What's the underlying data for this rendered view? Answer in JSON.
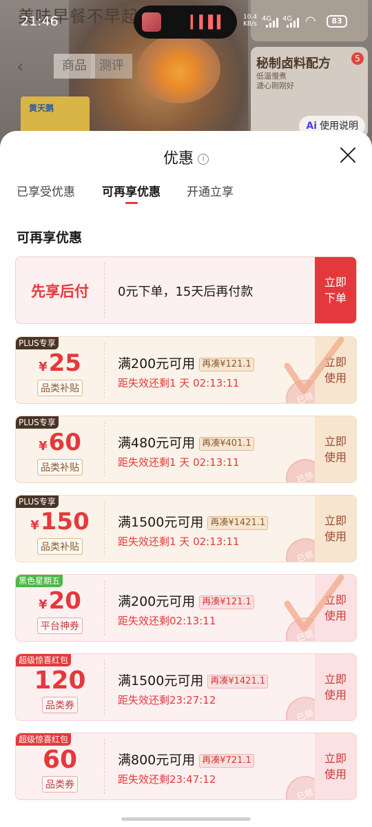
{
  "background": {
    "slogan": "美味早餐不早起",
    "tabs": [
      "商品",
      "测评"
    ],
    "product_brand": "黄天鹅",
    "card_title": "秘制卤料配方",
    "card_sub": [
      "低温慢煮",
      "溏心刚刚好"
    ],
    "card_badge": "5",
    "help_label": "使用说明",
    "help_icon": "Ai"
  },
  "status": {
    "time": "21:46",
    "net_speed": "10.4",
    "net_unit": "KB/s",
    "sig1": "4G",
    "sig2": "4G",
    "battery": "83"
  },
  "sheet": {
    "title": "优惠",
    "info_glyph": "i",
    "tabs": [
      "已享受优惠",
      "可再享优惠",
      "开通立享"
    ],
    "active_tab": 1,
    "section_title": "可再享优惠"
  },
  "pay_later": {
    "label": "先享后付",
    "desc": "0元下单，15天后再付款",
    "button": "立即下单"
  },
  "coupons": [
    {
      "tag": "PLUS专享",
      "amount": "25",
      "yen": "¥",
      "kind": "品类补贴",
      "cond": "满200元可用",
      "diff": "再凑¥121.1",
      "expire": "距失效还剩1 天 02:13:11",
      "button": "立即使用",
      "stamp": "已领",
      "checked": true
    },
    {
      "tag": "PLUS专享",
      "amount": "60",
      "yen": "¥",
      "kind": "品类补贴",
      "cond": "满480元可用",
      "diff": "再凑¥401.1",
      "expire": "距失效还剩1 天 02:13:11",
      "button": "立即使用",
      "stamp": "已领",
      "checked": false
    },
    {
      "tag": "PLUS专享",
      "amount": "150",
      "yen": "¥",
      "kind": "品类补贴",
      "cond": "满1500元可用",
      "diff": "再凑¥1421.1",
      "expire": "距失效还剩1 天 02:13:11",
      "button": "立即使用",
      "stamp": "已领",
      "checked": false
    },
    {
      "tag": "黑色星期五",
      "amount": "20",
      "yen": "¥",
      "kind": "平台神券",
      "cond": "满200元可用",
      "diff": "再凑¥121.1",
      "expire": "距失效还剩02:13:11",
      "button": "立即使用",
      "stamp": "已领",
      "checked": true
    },
    {
      "tag": "超级惊喜红包",
      "amount": "120",
      "yen": "",
      "kind": "品类券",
      "cond": "满1500元可用",
      "diff": "再凑¥1421.1",
      "expire": "距失效还剩23:27:12",
      "button": "立即使用",
      "stamp": "已领",
      "checked": false
    },
    {
      "tag": "超级惊喜红包",
      "amount": "60",
      "yen": "",
      "kind": "品类券",
      "cond": "满800元可用",
      "diff": "再凑¥721.1",
      "expire": "距失效还剩23:47:12",
      "button": "立即使用",
      "stamp": "已领",
      "checked": false
    }
  ],
  "colors": {
    "accent": "#e4393c",
    "plus_bg": "#fbf3e9",
    "red_bg": "#fdf0f0",
    "check": "#f0a98a"
  }
}
